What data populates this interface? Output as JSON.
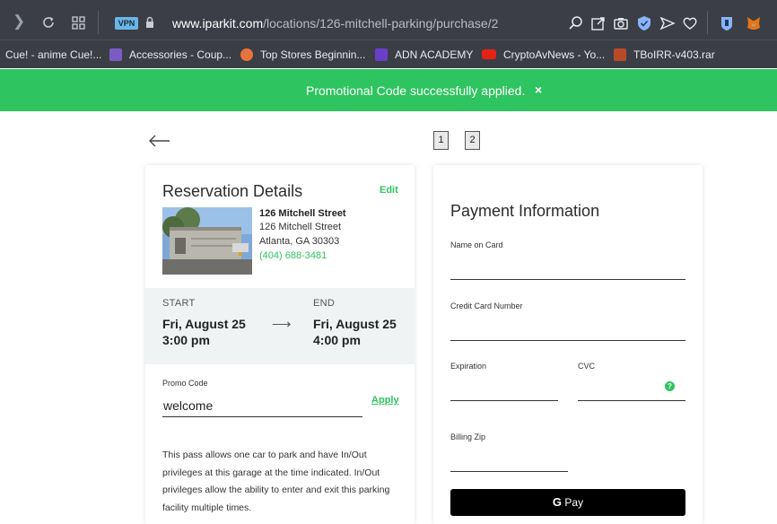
{
  "browser": {
    "url_domain": "www.iparkit.com",
    "url_path": "/locations/126-mitchell-parking/purchase/2",
    "vpn_label": "VPN",
    "bookmarks": [
      {
        "label": "Cue! - anime Cue!...",
        "icon": "none",
        "color": ""
      },
      {
        "label": "Accessories - Coup...",
        "icon": "coupon-icon",
        "color": "#7b5cc4"
      },
      {
        "label": "Top Stores Beginnin...",
        "icon": "store-icon",
        "color": "#e8743b"
      },
      {
        "label": "ADN ACADEMY",
        "icon": "list-icon",
        "color": "#6a3fc8"
      },
      {
        "label": "CryptoAvNews - Yo...",
        "icon": "youtube-icon",
        "color": "#e62117"
      },
      {
        "label": "TBoIRR-v403.rar",
        "icon": "archive-icon",
        "color": "#b84a2a"
      }
    ]
  },
  "banner": {
    "message": "Promotional Code successfully applied.",
    "close_glyph": "×",
    "color": "#2ec45f"
  },
  "steps": [
    "1",
    "2"
  ],
  "reservation": {
    "title": "Reservation Details",
    "edit_label": "Edit",
    "location_name": "126 Mitchell Street",
    "address_line1": "126 Mitchell Street",
    "address_line2": "Atlanta, GA 30303",
    "phone": "(404) 688-3481",
    "start_label": "START",
    "start_date": "Fri, August 25",
    "start_time": "3:00 pm",
    "end_label": "END",
    "end_date": "Fri, August 25",
    "end_time": "4:00 pm",
    "arrow_glyph": "⟶",
    "promo_label": "Promo Code",
    "promo_value": "welcome",
    "apply_label": "Apply",
    "pass_description": "This pass allows one car to park and have In/Out privileges at this garage at the time indicated. In/Out privileges allow the ability to enter and exit this parking facility multiple times."
  },
  "payment": {
    "title": "Payment Information",
    "name_label": "Name on Card",
    "card_label": "Credit Card Number",
    "expiration_label": "Expiration",
    "cvc_label": "CVC",
    "cvc_help_glyph": "?",
    "zip_label": "Billing Zip",
    "gpay_g": "G",
    "gpay_label": "Pay"
  }
}
